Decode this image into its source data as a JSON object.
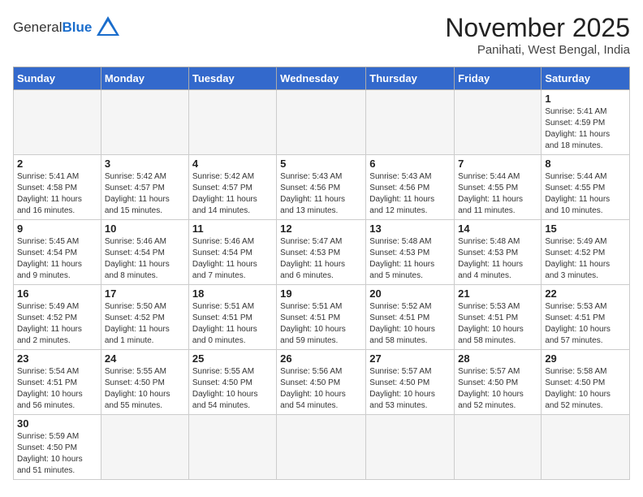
{
  "logo": {
    "general": "General",
    "blue": "Blue"
  },
  "title": "November 2025",
  "subtitle": "Panihati, West Bengal, India",
  "weekdays": [
    "Sunday",
    "Monday",
    "Tuesday",
    "Wednesday",
    "Thursday",
    "Friday",
    "Saturday"
  ],
  "weeks": [
    [
      {
        "day": "",
        "info": ""
      },
      {
        "day": "",
        "info": ""
      },
      {
        "day": "",
        "info": ""
      },
      {
        "day": "",
        "info": ""
      },
      {
        "day": "",
        "info": ""
      },
      {
        "day": "",
        "info": ""
      },
      {
        "day": "1",
        "info": "Sunrise: 5:41 AM\nSunset: 4:59 PM\nDaylight: 11 hours\nand 18 minutes."
      }
    ],
    [
      {
        "day": "2",
        "info": "Sunrise: 5:41 AM\nSunset: 4:58 PM\nDaylight: 11 hours\nand 16 minutes."
      },
      {
        "day": "3",
        "info": "Sunrise: 5:42 AM\nSunset: 4:57 PM\nDaylight: 11 hours\nand 15 minutes."
      },
      {
        "day": "4",
        "info": "Sunrise: 5:42 AM\nSunset: 4:57 PM\nDaylight: 11 hours\nand 14 minutes."
      },
      {
        "day": "5",
        "info": "Sunrise: 5:43 AM\nSunset: 4:56 PM\nDaylight: 11 hours\nand 13 minutes."
      },
      {
        "day": "6",
        "info": "Sunrise: 5:43 AM\nSunset: 4:56 PM\nDaylight: 11 hours\nand 12 minutes."
      },
      {
        "day": "7",
        "info": "Sunrise: 5:44 AM\nSunset: 4:55 PM\nDaylight: 11 hours\nand 11 minutes."
      },
      {
        "day": "8",
        "info": "Sunrise: 5:44 AM\nSunset: 4:55 PM\nDaylight: 11 hours\nand 10 minutes."
      }
    ],
    [
      {
        "day": "9",
        "info": "Sunrise: 5:45 AM\nSunset: 4:54 PM\nDaylight: 11 hours\nand 9 minutes."
      },
      {
        "day": "10",
        "info": "Sunrise: 5:46 AM\nSunset: 4:54 PM\nDaylight: 11 hours\nand 8 minutes."
      },
      {
        "day": "11",
        "info": "Sunrise: 5:46 AM\nSunset: 4:54 PM\nDaylight: 11 hours\nand 7 minutes."
      },
      {
        "day": "12",
        "info": "Sunrise: 5:47 AM\nSunset: 4:53 PM\nDaylight: 11 hours\nand 6 minutes."
      },
      {
        "day": "13",
        "info": "Sunrise: 5:48 AM\nSunset: 4:53 PM\nDaylight: 11 hours\nand 5 minutes."
      },
      {
        "day": "14",
        "info": "Sunrise: 5:48 AM\nSunset: 4:53 PM\nDaylight: 11 hours\nand 4 minutes."
      },
      {
        "day": "15",
        "info": "Sunrise: 5:49 AM\nSunset: 4:52 PM\nDaylight: 11 hours\nand 3 minutes."
      }
    ],
    [
      {
        "day": "16",
        "info": "Sunrise: 5:49 AM\nSunset: 4:52 PM\nDaylight: 11 hours\nand 2 minutes."
      },
      {
        "day": "17",
        "info": "Sunrise: 5:50 AM\nSunset: 4:52 PM\nDaylight: 11 hours\nand 1 minute."
      },
      {
        "day": "18",
        "info": "Sunrise: 5:51 AM\nSunset: 4:51 PM\nDaylight: 11 hours\nand 0 minutes."
      },
      {
        "day": "19",
        "info": "Sunrise: 5:51 AM\nSunset: 4:51 PM\nDaylight: 10 hours\nand 59 minutes."
      },
      {
        "day": "20",
        "info": "Sunrise: 5:52 AM\nSunset: 4:51 PM\nDaylight: 10 hours\nand 58 minutes."
      },
      {
        "day": "21",
        "info": "Sunrise: 5:53 AM\nSunset: 4:51 PM\nDaylight: 10 hours\nand 58 minutes."
      },
      {
        "day": "22",
        "info": "Sunrise: 5:53 AM\nSunset: 4:51 PM\nDaylight: 10 hours\nand 57 minutes."
      }
    ],
    [
      {
        "day": "23",
        "info": "Sunrise: 5:54 AM\nSunset: 4:51 PM\nDaylight: 10 hours\nand 56 minutes."
      },
      {
        "day": "24",
        "info": "Sunrise: 5:55 AM\nSunset: 4:50 PM\nDaylight: 10 hours\nand 55 minutes."
      },
      {
        "day": "25",
        "info": "Sunrise: 5:55 AM\nSunset: 4:50 PM\nDaylight: 10 hours\nand 54 minutes."
      },
      {
        "day": "26",
        "info": "Sunrise: 5:56 AM\nSunset: 4:50 PM\nDaylight: 10 hours\nand 54 minutes."
      },
      {
        "day": "27",
        "info": "Sunrise: 5:57 AM\nSunset: 4:50 PM\nDaylight: 10 hours\nand 53 minutes."
      },
      {
        "day": "28",
        "info": "Sunrise: 5:57 AM\nSunset: 4:50 PM\nDaylight: 10 hours\nand 52 minutes."
      },
      {
        "day": "29",
        "info": "Sunrise: 5:58 AM\nSunset: 4:50 PM\nDaylight: 10 hours\nand 52 minutes."
      }
    ],
    [
      {
        "day": "30",
        "info": "Sunrise: 5:59 AM\nSunset: 4:50 PM\nDaylight: 10 hours\nand 51 minutes."
      },
      {
        "day": "",
        "info": ""
      },
      {
        "day": "",
        "info": ""
      },
      {
        "day": "",
        "info": ""
      },
      {
        "day": "",
        "info": ""
      },
      {
        "day": "",
        "info": ""
      },
      {
        "day": "",
        "info": ""
      }
    ]
  ]
}
